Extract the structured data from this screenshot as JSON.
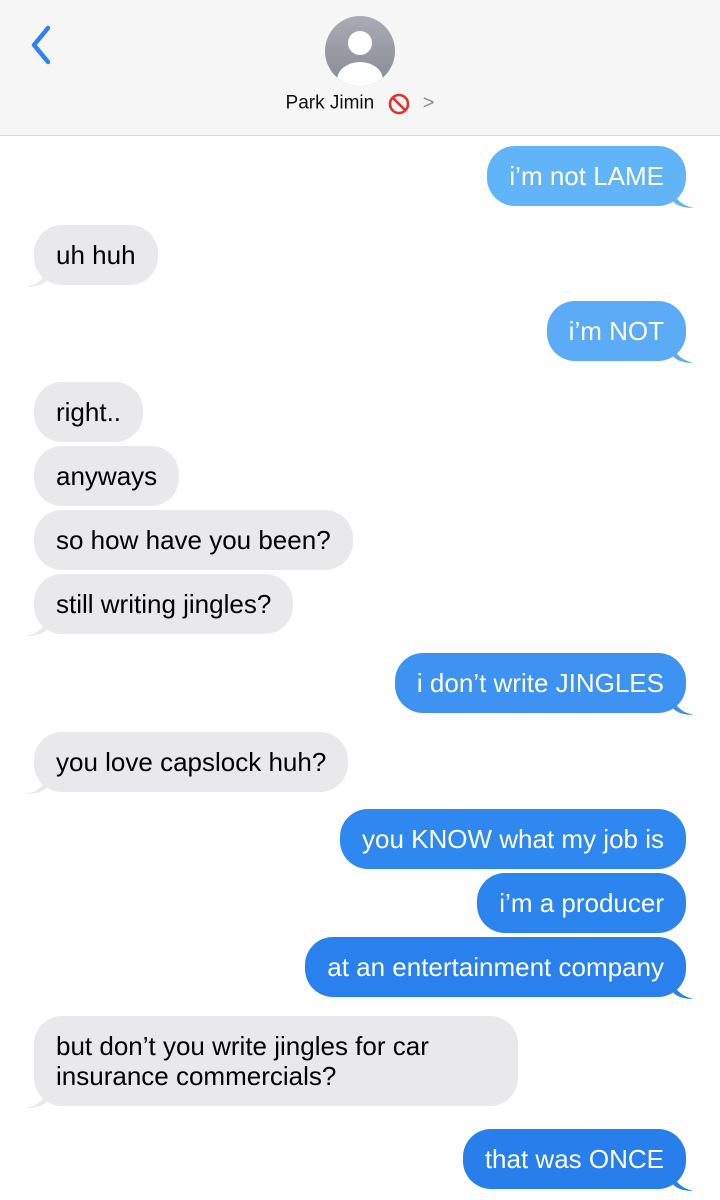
{
  "header": {
    "contact_name": "Park Jimin",
    "back_icon": "chevron-left-icon",
    "blocked_icon": "prohibited-icon",
    "details_icon": "chevron-right-icon",
    "details_glyph": ">"
  },
  "colors": {
    "incoming_bubble": "#e9e9eb",
    "outgoing_bubble_light": "#5eb1f8",
    "outgoing_bubble_dark": "#1f7bea",
    "accent": "#2d82f6",
    "blocked_red": "#e0322c"
  },
  "messages": [
    {
      "from": "me",
      "text": "i’m not LAME"
    },
    {
      "from": "them",
      "text": "uh huh"
    },
    {
      "from": "me",
      "text": "i’m NOT"
    },
    {
      "from": "them",
      "text": "right.."
    },
    {
      "from": "them",
      "text": "anyways"
    },
    {
      "from": "them",
      "text": "so how have you been?"
    },
    {
      "from": "them",
      "text": "still writing jingles?"
    },
    {
      "from": "me",
      "text": "i don’t write JINGLES"
    },
    {
      "from": "them",
      "text": "you love capslock huh?"
    },
    {
      "from": "me",
      "text": "you KNOW what my job is"
    },
    {
      "from": "me",
      "text": "i’m a producer"
    },
    {
      "from": "me",
      "text": "at an entertainment company"
    },
    {
      "from": "them",
      "text": "but don’t you write jingles for car insurance commercials?",
      "lines": [
        "but don’t you write jingles for car",
        "insurance commercials?"
      ]
    },
    {
      "from": "me",
      "text": "that was ONCE"
    }
  ]
}
